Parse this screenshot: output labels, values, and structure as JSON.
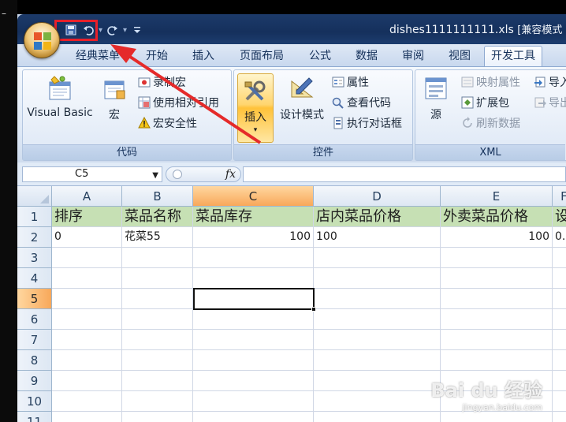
{
  "left_edge_text": "–",
  "window": {
    "title": "dishes1111111111.xls",
    "compat_tag": "[兼容模式"
  },
  "qat": {
    "save_icon": "save-icon",
    "undo_icon": "undo-icon",
    "redo_icon": "redo-icon",
    "customize_icon": "customize-qat-icon"
  },
  "tabs": [
    {
      "label": "经典菜单"
    },
    {
      "label": "开始"
    },
    {
      "label": "插入"
    },
    {
      "label": "页面布局"
    },
    {
      "label": "公式"
    },
    {
      "label": "数据"
    },
    {
      "label": "审阅"
    },
    {
      "label": "视图"
    },
    {
      "label": "开发工具"
    }
  ],
  "ribbon": {
    "code_group": {
      "label": "代码",
      "visual_basic": "Visual Basic",
      "macros": "宏",
      "record_macro": "录制宏",
      "relative_ref": "使用相对引用",
      "macro_security": "宏安全性"
    },
    "controls_group": {
      "label": "控件",
      "insert": "插入",
      "design_mode": "设计模式",
      "properties": "属性",
      "view_code": "查看代码",
      "run_dialog": "执行对话框"
    },
    "xml_group": {
      "label": "XML",
      "source": "源",
      "map_properties": "映射属性",
      "expansion_packs": "扩展包",
      "refresh_data": "刷新数据",
      "import": "导入",
      "export": "导出"
    }
  },
  "formula_bar": {
    "name_box": "C5",
    "fx": "fx"
  },
  "grid": {
    "columns": [
      "A",
      "B",
      "C",
      "D",
      "E",
      "F"
    ],
    "rows": [
      "1",
      "2",
      "3",
      "4",
      "5",
      "6",
      "7",
      "8",
      "9",
      "10",
      "11"
    ],
    "row1": [
      "排序",
      "菜品名称",
      "菜品库存",
      "店内菜品价格",
      "外卖菜品价格",
      "设"
    ],
    "row2": [
      "0",
      "花菜55",
      "100",
      "100",
      "100",
      "0."
    ]
  },
  "watermark": {
    "main": "Bai du 经验",
    "sub": "jingyan.baidu.com"
  }
}
